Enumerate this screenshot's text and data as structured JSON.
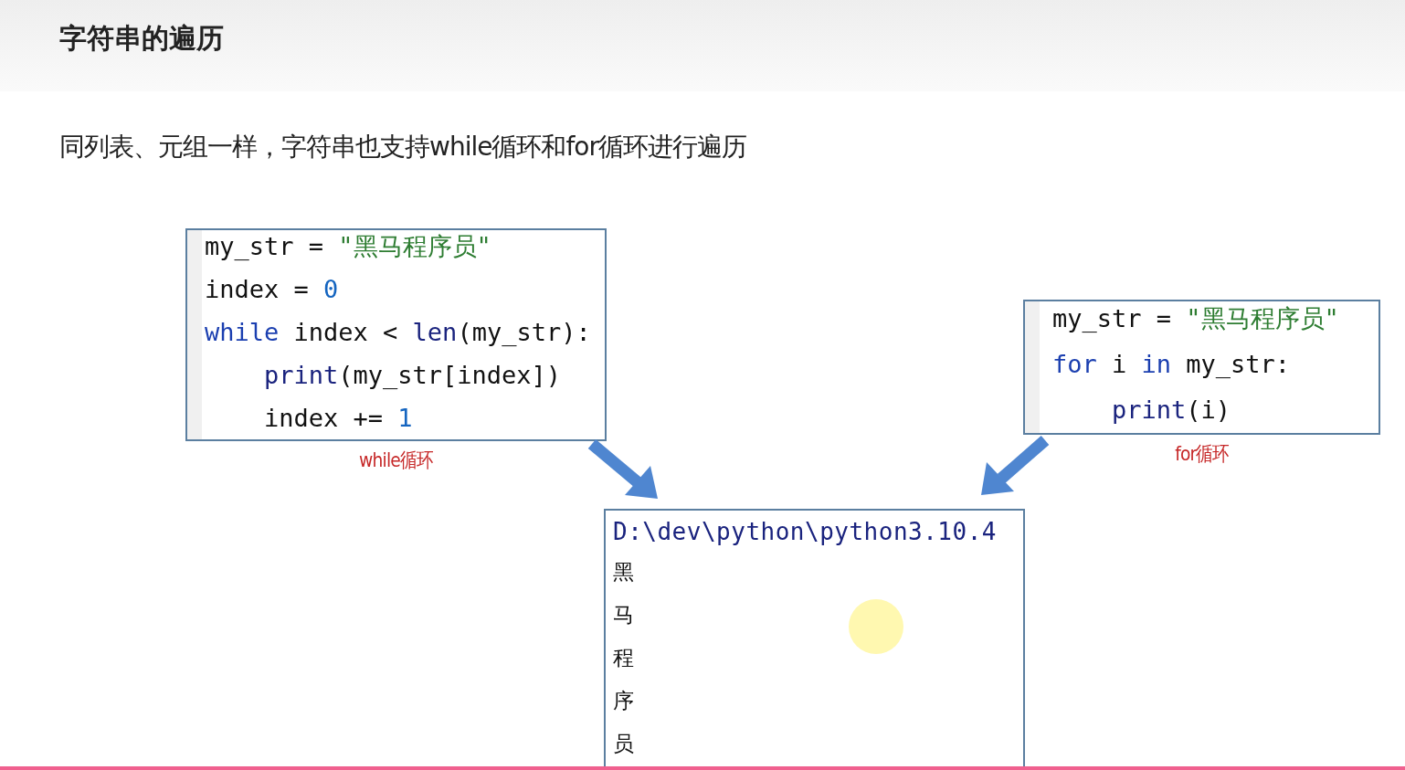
{
  "title": "字符串的遍历",
  "description": "同列表、元组一样，字符串也支持while循环和for循环进行遍历",
  "code_blocks": [
    {
      "caption": "while循环",
      "lines": [
        {
          "indented": false,
          "tokens": [
            {
              "kind": "plain",
              "text": "my_str = "
            },
            {
              "kind": "string",
              "text": "\"黑马程序员\""
            }
          ]
        },
        {
          "indented": false,
          "tokens": [
            {
              "kind": "plain",
              "text": "index = "
            },
            {
              "kind": "number",
              "text": "0"
            }
          ]
        },
        {
          "indented": false,
          "tokens": [
            {
              "kind": "keyword",
              "text": "while"
            },
            {
              "kind": "plain",
              "text": " index < "
            },
            {
              "kind": "builtin",
              "text": "len"
            },
            {
              "kind": "plain",
              "text": "(my_str):"
            }
          ]
        },
        {
          "indented": true,
          "tokens": [
            {
              "kind": "builtin",
              "text": "print"
            },
            {
              "kind": "plain",
              "text": "(my_str[index])"
            }
          ]
        },
        {
          "indented": true,
          "tokens": [
            {
              "kind": "plain",
              "text": "index += "
            },
            {
              "kind": "number",
              "text": "1"
            }
          ]
        }
      ]
    },
    {
      "caption": "for循环",
      "lines": [
        {
          "indented": false,
          "tokens": [
            {
              "kind": "plain",
              "text": "my_str = "
            },
            {
              "kind": "string",
              "text": "\"黑马程序员\""
            }
          ]
        },
        {
          "indented": false,
          "tokens": [
            {
              "kind": "keyword",
              "text": "for"
            },
            {
              "kind": "plain",
              "text": " i "
            },
            {
              "kind": "keyword",
              "text": "in"
            },
            {
              "kind": "plain",
              "text": " my_str:"
            }
          ]
        },
        {
          "indented": true,
          "tokens": [
            {
              "kind": "builtin",
              "text": "print"
            },
            {
              "kind": "plain",
              "text": "(i)"
            }
          ]
        }
      ]
    }
  ],
  "console": {
    "path": "D:\\dev\\python\\python3.10.4",
    "output": [
      "黑",
      "马",
      "程",
      "序",
      "员"
    ]
  }
}
